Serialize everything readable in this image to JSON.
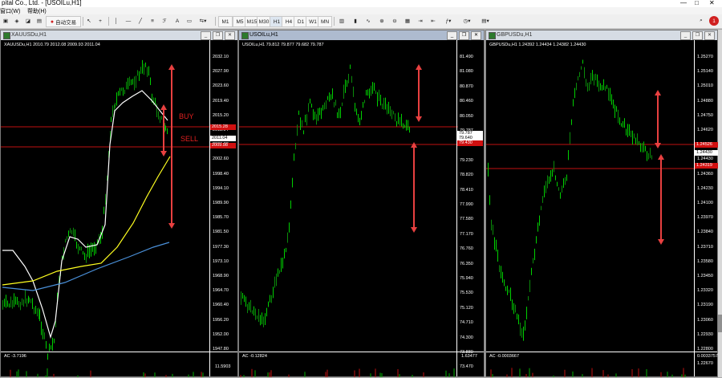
{
  "app": {
    "title": "pital Co., Ltd. - [USOILu,H1]",
    "window_controls": [
      "—",
      "□",
      "✕"
    ]
  },
  "menu": [
    "窗口(W)",
    "帮助(H)"
  ],
  "toolbar": {
    "auto_trade": "自动交易",
    "timeframes": [
      "M1",
      "M5",
      "M15",
      "M30",
      "H1",
      "H4",
      "D1",
      "W1",
      "MN"
    ],
    "notification_count": "1"
  },
  "windows": [
    {
      "title": "XAUUSDu,H1",
      "header": "XAUUSDu,H1  2010.79 2012.08 2009.93 2011.04",
      "ticks": [
        "2032.10",
        "2027.90",
        "2023.60",
        "2019.40",
        "2015.20",
        "2011.04",
        "2006.80",
        "2002.60",
        "1998.40",
        "1994.10",
        "1989.90",
        "1985.70",
        "1981.50",
        "1977.30",
        "1973.10",
        "1968.90",
        "1964.70",
        "1960.40",
        "1956.20",
        "1952.00",
        "1947.80"
      ],
      "markers": [
        {
          "label": "2015.28",
          "color": "#d01010"
        },
        {
          "label": "2011.04",
          "color": "#ffffff"
        },
        {
          "label": "2009.98",
          "color": "#d01010"
        }
      ],
      "indicator_label": "AC -3.7196",
      "indicator_top": "11.5903",
      "annotations": [
        "BUY",
        "SELL"
      ],
      "active": false
    },
    {
      "title": "USOILu,H1",
      "header": "USOILu,H1  79.812 79.877 79.682 79.787",
      "ticks": [
        "81.490",
        "81.080",
        "80.870",
        "80.460",
        "80.050",
        "79.787",
        "79.640",
        "79.230",
        "78.820",
        "78.410",
        "77.990",
        "77.580",
        "77.170",
        "76.760",
        "76.350",
        "75.940",
        "75.530",
        "75.120",
        "74.710",
        "74.300",
        "73.880",
        "73.470"
      ],
      "markers": [
        {
          "label": "79.787",
          "color": "#ffffff"
        },
        {
          "label": "79.640",
          "color": "#ffffff"
        },
        {
          "label": "79.430",
          "color": "#d01010"
        }
      ],
      "indicator_label": "AC -0.12824",
      "indicator_top": "1.63477",
      "annotations": [],
      "active": true
    },
    {
      "title": "GBPUSDu,H1",
      "header": "GBPUSDu,H1  1.24392 1.24434 1.24382 1.24430",
      "ticks": [
        "1.25270",
        "1.25140",
        "1.25010",
        "1.24880",
        "1.24750",
        "1.24620",
        "1.24490",
        "1.24430",
        "1.24360",
        "1.24230",
        "1.24100",
        "1.23970",
        "1.23840",
        "1.23710",
        "1.23580",
        "1.23450",
        "1.23320",
        "1.23190",
        "1.23060",
        "1.22930",
        "1.22800",
        "1.22670"
      ],
      "markers": [
        {
          "label": "1.24430",
          "color": "#ffffff"
        },
        {
          "label": "1.24526",
          "color": "#d01010"
        },
        {
          "label": "1.24319",
          "color": "#d01010"
        }
      ],
      "indicator_label": "AC -0.0003667",
      "indicator_top": "0.0033757",
      "annotations": [],
      "active": false
    }
  ],
  "colors": {
    "bull": "#00d000",
    "bear": "#0a8a0a",
    "ma_fast": "#ffffff",
    "ma_mid": "#ffff20",
    "ma_slow": "#4a90d9",
    "level": "#c01010",
    "arrow": "#e84040"
  }
}
